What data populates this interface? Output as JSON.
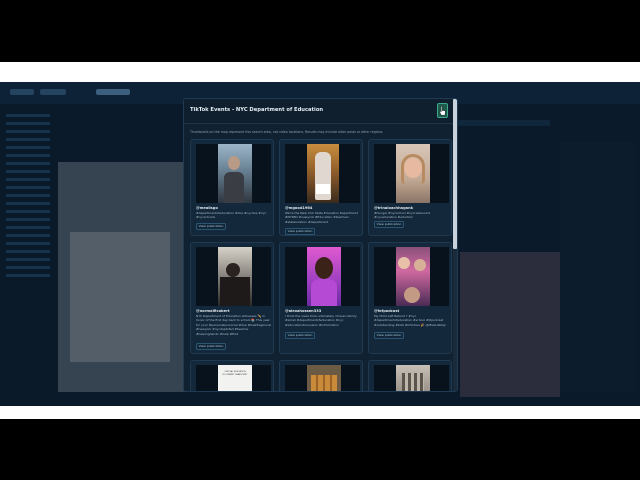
{
  "modal": {
    "title": "TikTok Events - NYC Department of Education",
    "note": "Thumbnails on the map represent this search area, not video locations. Results may include older posts or other regions.",
    "close_icon": "close-pointer-icon",
    "cards": [
      {
        "handle": "@meallsgo",
        "desc": "#departmentofeducation #doe #nycdoe #nyc #nycschools",
        "button": "View publication"
      },
      {
        "handle": "@mgood1964",
        "desc": "We're the New York State Education Department #NYSED #newyork #Education #teachers #statelocation #department",
        "button": "View publication"
      },
      {
        "handle": "@trinaloachhagank",
        "desc": "#hunger #nycschool #nycrestaurant #nyceducation #eduction",
        "button": "View publication"
      },
      {
        "handle": "@normalficobert",
        "desc": "NYC Department of Education witnesses ✏️ in honor of the first day back to school 📚 This year for your #personalprosocial #doe #hashtagmoral #newyork #nycdeptofed #teacher #helpinghands #help #first",
        "button": "View publication"
      },
      {
        "handle": "@alexahossen333",
        "desc": "I think the news time untimately. Chosen family #email #departmentofeducation #nyc #educationdiscussion #information",
        "button": "View publication"
      },
      {
        "handle": "@fofpodcast",
        "desc": "My Child Left Behind ? #nyc #departmentofeducation #school #ldpodcast #outstanding #kids #Children 🎉 @MissLizKlaji",
        "button": "View publication"
      },
      {
        "handle": "",
        "desc": "",
        "button": ""
      },
      {
        "handle": "",
        "desc": "",
        "button": ""
      },
      {
        "handle": "",
        "desc": "",
        "button": ""
      }
    ],
    "thumb7_caption": "OFFICIAL EDUCATION DOCUMENT TRANSCRIPT"
  }
}
